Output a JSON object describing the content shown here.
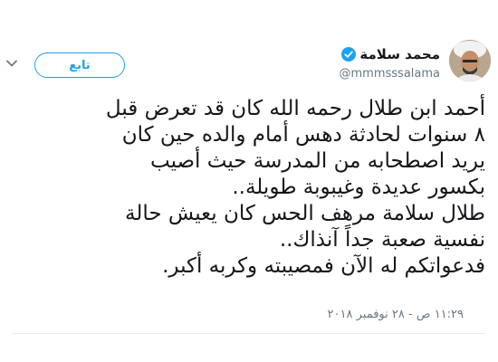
{
  "author": {
    "display_name": "محمد سلامة",
    "handle": "@mmmsssalama",
    "verified": true
  },
  "follow_button": {
    "label": "تابع"
  },
  "tweet": {
    "lines": [
      "أحمد ابن طلال رحمه الله كان قد تعرض قبل",
      "٨ سنوات لحادثة دهس أمام والده حين كان",
      "يريد اصطحابه من المدرسة حيث أصيب",
      "بكسور عديدة وغيبوبة طويلة..",
      "طلال سلامة مرهف الحس كان يعيش حالة",
      "نفسية صعبة جداً آنذاك..",
      "فدعواتكم له الآن فمصيبته وكربه أكبر."
    ],
    "timestamp": "١١:٢٩ ص - ٢٨ نوفمبر ٢٠١٨"
  },
  "icons": {
    "verified": "verified-badge-icon",
    "caret": "chevron-down-icon"
  },
  "colors": {
    "accent": "#1da1f2",
    "secondary_text": "#657786",
    "text": "#14171a"
  }
}
